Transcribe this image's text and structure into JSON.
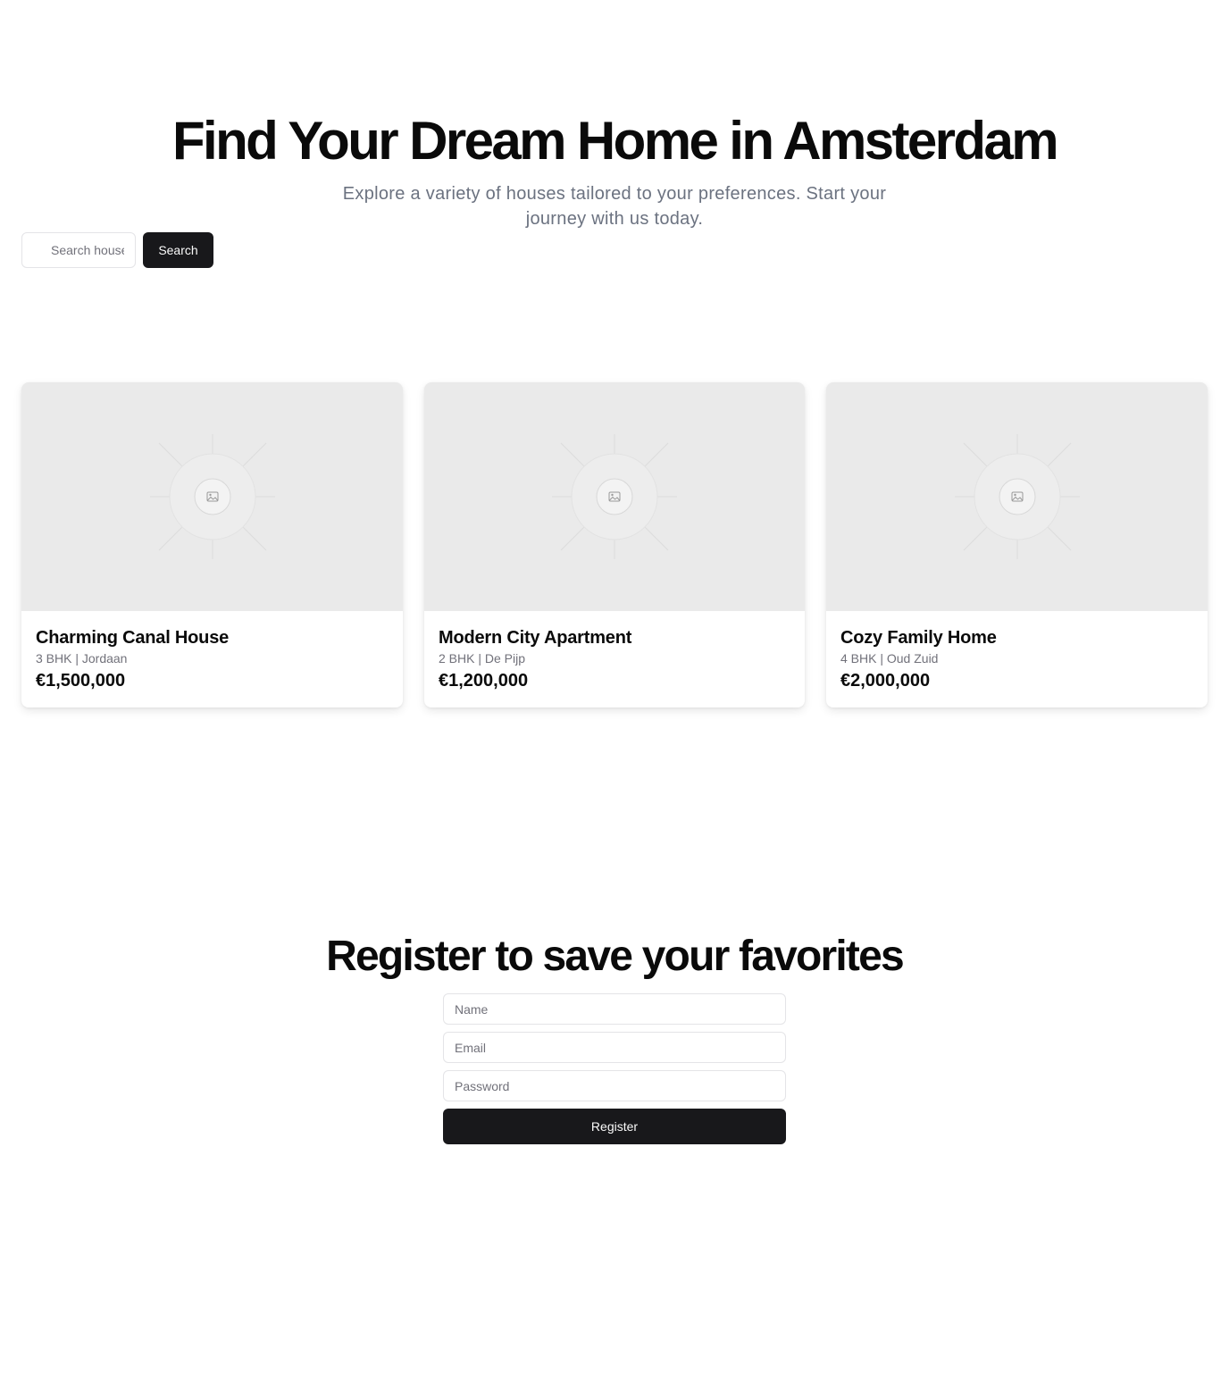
{
  "hero": {
    "title": "Find Your Dream Home in Amsterdam",
    "subtitle": "Explore a variety of houses tailored to your preferences. Start your journey with us today."
  },
  "search": {
    "placeholder": "Search houses",
    "button_label": "Search"
  },
  "listings": [
    {
      "title": "Charming Canal House",
      "meta": "3 BHK | Jordaan",
      "price": "€1,500,000",
      "image_icon": "image-placeholder-icon"
    },
    {
      "title": "Modern City Apartment",
      "meta": "2 BHK | De Pijp",
      "price": "€1,200,000",
      "image_icon": "image-placeholder-icon"
    },
    {
      "title": "Cozy Family Home",
      "meta": "4 BHK | Oud Zuid",
      "price": "€2,000,000",
      "image_icon": "image-placeholder-icon"
    }
  ],
  "register": {
    "title": "Register to save your favorites",
    "name_placeholder": "Name",
    "email_placeholder": "Email",
    "password_placeholder": "Password",
    "button_label": "Register"
  },
  "colors": {
    "primary_button": "#18181b",
    "muted_text": "#6b7280",
    "image_placeholder_bg": "#eaeaea"
  }
}
